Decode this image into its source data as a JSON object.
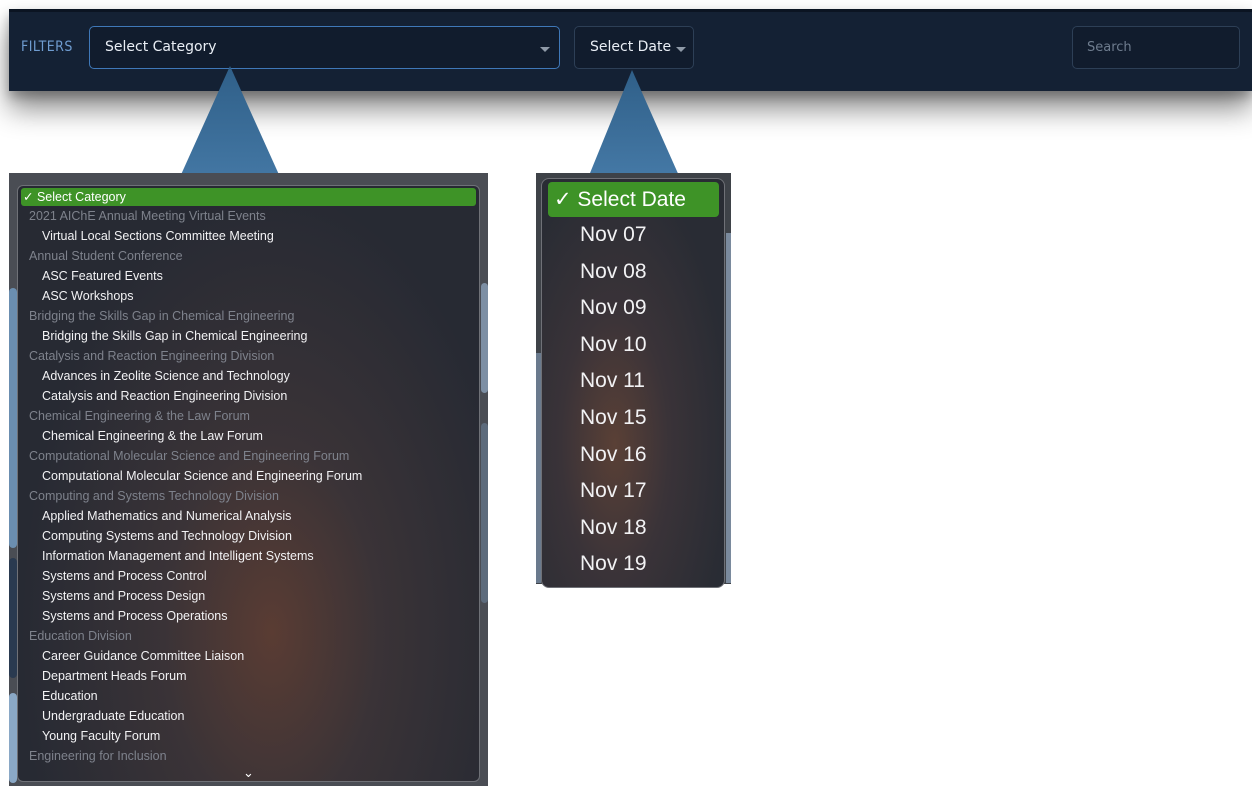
{
  "filter_bar": {
    "label": "FILTERS",
    "category_select": {
      "value": "Select Category"
    },
    "date_select": {
      "value": "Select Date"
    },
    "search": {
      "placeholder": "Search"
    }
  },
  "category_dropdown": {
    "rows": [
      {
        "type": "selected",
        "label": "✓ Select Category"
      },
      {
        "type": "group",
        "label": "2021 AIChE Annual Meeting Virtual Events"
      },
      {
        "type": "option",
        "label": "Virtual Local Sections Committee Meeting"
      },
      {
        "type": "group",
        "label": "Annual Student Conference"
      },
      {
        "type": "option",
        "label": "ASC Featured Events"
      },
      {
        "type": "option",
        "label": "ASC Workshops"
      },
      {
        "type": "group",
        "label": "Bridging the Skills Gap in Chemical Engineering"
      },
      {
        "type": "option",
        "label": "Bridging the Skills Gap in Chemical Engineering"
      },
      {
        "type": "group",
        "label": "Catalysis and Reaction Engineering Division"
      },
      {
        "type": "option",
        "label": "Advances in Zeolite Science and Technology"
      },
      {
        "type": "option",
        "label": "Catalysis and Reaction Engineering Division"
      },
      {
        "type": "group",
        "label": "Chemical Engineering & the Law Forum"
      },
      {
        "type": "option",
        "label": "Chemical Engineering & the Law Forum"
      },
      {
        "type": "group",
        "label": "Computational Molecular Science and Engineering Forum"
      },
      {
        "type": "option",
        "label": "Computational Molecular Science and Engineering Forum"
      },
      {
        "type": "group",
        "label": "Computing and Systems Technology Division"
      },
      {
        "type": "option",
        "label": "Applied Mathematics and Numerical Analysis"
      },
      {
        "type": "option",
        "label": "Computing Systems and Technology Division"
      },
      {
        "type": "option",
        "label": "Information Management and Intelligent Systems"
      },
      {
        "type": "option",
        "label": "Systems and Process Control"
      },
      {
        "type": "option",
        "label": "Systems and Process Design"
      },
      {
        "type": "option",
        "label": "Systems and Process Operations"
      },
      {
        "type": "group",
        "label": "Education Division"
      },
      {
        "type": "option",
        "label": "Career Guidance Committee Liaison"
      },
      {
        "type": "option",
        "label": "Department Heads Forum"
      },
      {
        "type": "option",
        "label": "Education"
      },
      {
        "type": "option",
        "label": "Undergraduate Education"
      },
      {
        "type": "option",
        "label": "Young Faculty Forum"
      },
      {
        "type": "group",
        "label": "Engineering for Inclusion"
      }
    ],
    "scroll_more_glyph": "⌄"
  },
  "date_dropdown": {
    "rows": [
      {
        "type": "selected",
        "label": "✓ Select Date"
      },
      {
        "type": "option",
        "label": "Nov 07"
      },
      {
        "type": "option",
        "label": "Nov 08"
      },
      {
        "type": "option",
        "label": "Nov 09"
      },
      {
        "type": "option",
        "label": "Nov 10"
      },
      {
        "type": "option",
        "label": "Nov 11"
      },
      {
        "type": "option",
        "label": "Nov 15"
      },
      {
        "type": "option",
        "label": "Nov 16"
      },
      {
        "type": "option",
        "label": "Nov 17"
      },
      {
        "type": "option",
        "label": "Nov 18"
      },
      {
        "type": "option",
        "label": "Nov 19"
      }
    ]
  },
  "colors": {
    "bar_background": "#142134",
    "accent_blue": "#3f78b8",
    "callout_blue": "#3d6a92",
    "selected_green": "#3e9327"
  },
  "icons": {
    "select_caret": "caret-down-icon",
    "checkmark": "checkmark-icon",
    "scroll_more": "chevron-down-icon"
  }
}
